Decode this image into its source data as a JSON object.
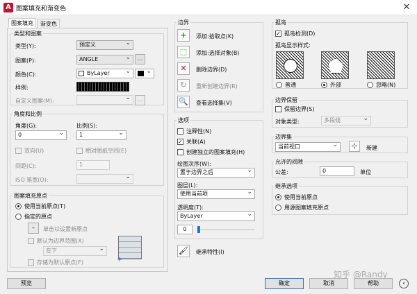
{
  "title": "图案填充和渐变色",
  "tabs": [
    "图案填充",
    "渐变色"
  ],
  "type_pattern": {
    "group": "类型和图案",
    "type_label": "类型(Y):",
    "type_value": "预定义",
    "pattern_label": "图案(P):",
    "pattern_value": "ANGLE",
    "color_label": "颜色(C):",
    "color_value": "ByLayer",
    "swatch_label": "样例:",
    "custom_label": "自定义图案(M):",
    "ellipsis": "..."
  },
  "angle_scale": {
    "group": "角度和比例",
    "angle_label": "角度(G):",
    "angle_value": "0",
    "scale_label": "比例(S):",
    "scale_value": "1",
    "double_label": "双向(U)",
    "relative_label": "相对图纸空间(E)",
    "spacing_label": "间距(C):",
    "spacing_value": "1",
    "iso_label": "ISO 笔宽(O):"
  },
  "origin": {
    "group": "图案填充原点",
    "use_current": "使用当前原点(T)",
    "specified": "指定的原点",
    "click_set": "单击以设置新原点",
    "default_extents": "默认为边界范围(X)",
    "position": "左下",
    "store_default": "存储为默认原点(F)"
  },
  "boundary": {
    "group": "边界",
    "add_pick": "添加:拾取点(K)",
    "add_select": "添加:选择对象(B)",
    "remove": "删除边界(D)",
    "recreate": "重新创建边界(R)",
    "view_sel": "查看选择集(V)"
  },
  "options": {
    "group": "选项",
    "annotative": "注释性(N)",
    "associative": "关联(A)",
    "separate": "创建独立的图案填充(H)",
    "draw_order_label": "绘图次序(W):",
    "draw_order": "置于边界之后",
    "layer_label": "图层(L):",
    "layer": "使用当前项",
    "transparency_label": "透明度(T):",
    "transparency": "ByLayer",
    "transparency_value": "0"
  },
  "inherit": "继承特性(I)",
  "islands": {
    "group": "孤岛",
    "detect": "孤岛检测(D)",
    "style_label": "孤岛显示样式:",
    "styles": [
      "普通",
      "外部",
      "忽略(N)"
    ]
  },
  "retain": {
    "group": "边界保留",
    "retain_label": "保留边界(S)",
    "type_label": "对象类型:",
    "type_value": "多段线"
  },
  "boundary_set": {
    "group": "边界集",
    "value": "当前视口",
    "new_label": "新建"
  },
  "gap": {
    "group": "允许的间隙",
    "tol_label": "公差:",
    "tol_value": "0",
    "unit": "单位"
  },
  "inherit_opts": {
    "group": "继承选项",
    "use_current": "使用当前原点",
    "use_source": "用源图案填充原点"
  },
  "footer": {
    "preview": "预览",
    "ok": "确定",
    "cancel": "取消",
    "help": "帮助",
    "watermark": "知乎 @Randy"
  }
}
